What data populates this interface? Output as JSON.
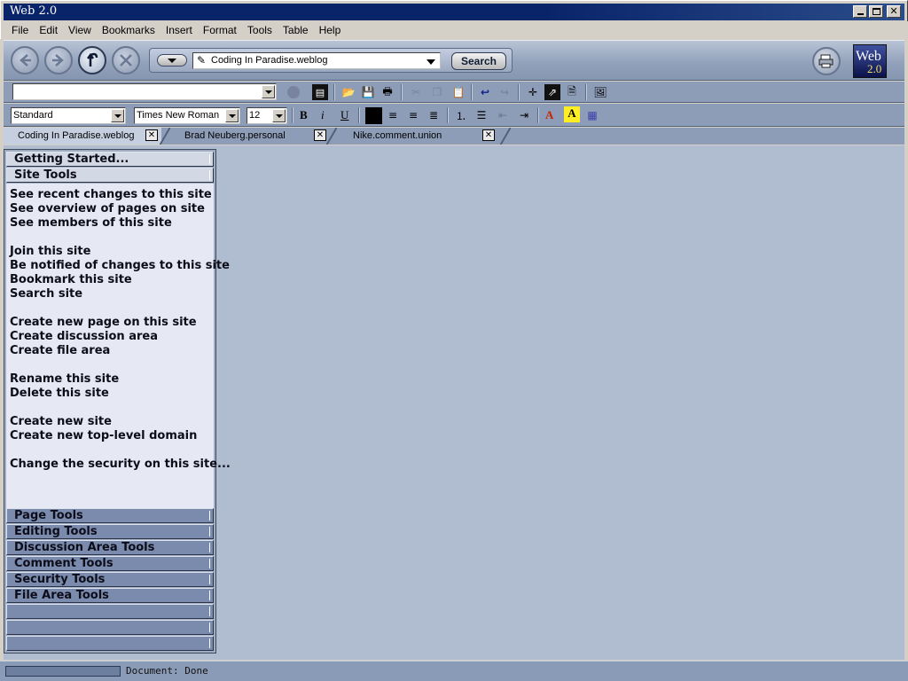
{
  "window": {
    "title": "Web 2.0"
  },
  "menu": [
    "File",
    "Edit",
    "View",
    "Bookmarks",
    "Insert",
    "Format",
    "Tools",
    "Table",
    "Help"
  ],
  "nav": {
    "url": "Coding In Paradise.weblog",
    "search_label": "Search",
    "logo_line1": "Web",
    "logo_line2": "2.0"
  },
  "edit_toolbar": {
    "address_value": ""
  },
  "format_toolbar": {
    "paragraph_style": "Standard",
    "font": "Times New Roman",
    "size": "12",
    "bold": "B",
    "italic": "i",
    "underline": "U",
    "font_color_glyph": "A",
    "highlight_glyph": "A",
    "font_color": "#cc2200",
    "highlight_color": "#ffee22"
  },
  "tabs": [
    {
      "label": "Coding In Paradise.weblog",
      "active": true
    },
    {
      "label": "Brad Neuberg.personal",
      "active": false
    },
    {
      "label": "Nike.comment.union",
      "active": false
    }
  ],
  "sidebar": {
    "top_headers": [
      "Getting Started...",
      "Site Tools"
    ],
    "links": [
      "See recent changes to this site",
      "See overview of pages on site",
      "See members of this site",
      "Join this site",
      "Be notified of changes to this site",
      "Bookmark this site",
      "Search site",
      "Create new page on this site",
      "Create discussion area",
      "Create file area",
      "Rename this site",
      "Delete this site",
      "Create new site",
      "Create new top-level domain",
      "Change the security on this site..."
    ],
    "bottom_headers": [
      "Page Tools",
      "Editing Tools",
      "Discussion Area Tools",
      "Comment Tools",
      "Security Tools",
      "File Area Tools",
      "",
      "",
      ""
    ]
  },
  "status": {
    "text": "Document: Done",
    "progress": 1.0
  }
}
